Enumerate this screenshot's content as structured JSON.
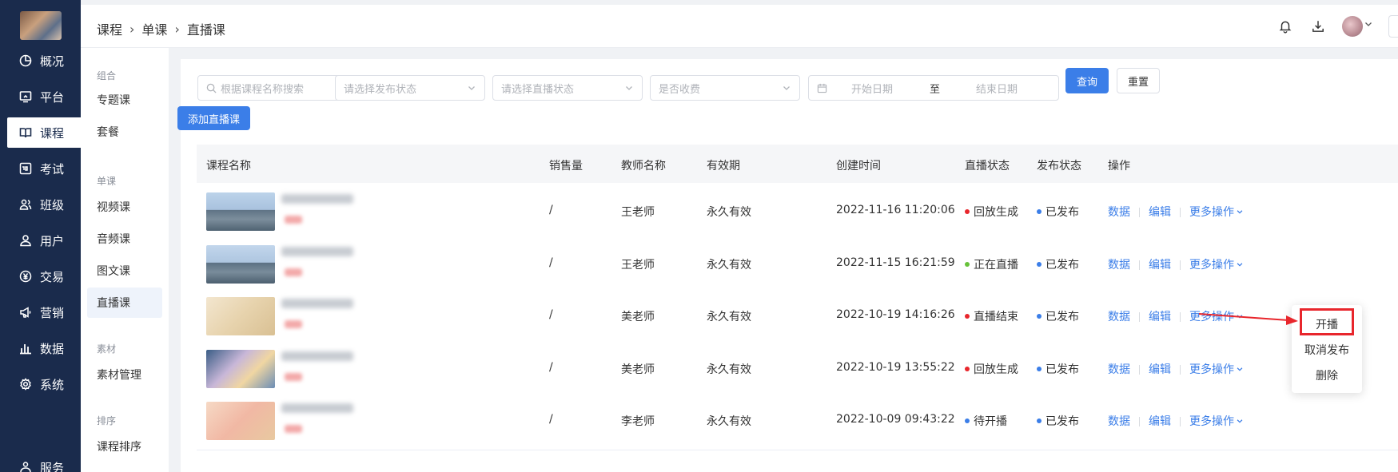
{
  "nav": {
    "items": [
      {
        "label": "概况",
        "icon": "pie-chart-icon"
      },
      {
        "label": "平台",
        "icon": "monitor-icon"
      },
      {
        "label": "课程",
        "icon": "book-icon",
        "active": true
      },
      {
        "label": "考试",
        "icon": "score-icon"
      },
      {
        "label": "班级",
        "icon": "group-icon"
      },
      {
        "label": "用户",
        "icon": "user-icon"
      },
      {
        "label": "交易",
        "icon": "yen-icon"
      },
      {
        "label": "营销",
        "icon": "megaphone-icon"
      },
      {
        "label": "数据",
        "icon": "bar-chart-icon"
      },
      {
        "label": "系统",
        "icon": "gear-icon"
      },
      {
        "label": "服务",
        "icon": "service-icon"
      }
    ]
  },
  "subnav": {
    "groups": [
      {
        "title": "组合",
        "items": [
          "专题课",
          "套餐"
        ]
      },
      {
        "title": "单课",
        "items": [
          "视频课",
          "音频课",
          "图文课",
          "直播课"
        ]
      },
      {
        "title": "素材",
        "items": [
          "素材管理"
        ]
      },
      {
        "title": "排序",
        "items": [
          "课程排序"
        ]
      }
    ],
    "active": "直播课"
  },
  "breadcrumb": [
    "课程",
    "单课",
    "直播课"
  ],
  "filters": {
    "search_placeholder": "根据课程名称搜索",
    "publish_placeholder": "请选择发布状态",
    "live_placeholder": "请选择直播状态",
    "fee_placeholder": "是否收费",
    "start_placeholder": "开始日期",
    "range_sep": "至",
    "end_placeholder": "结束日期",
    "query_label": "查询",
    "reset_label": "重置"
  },
  "add_button": "添加直播课",
  "table": {
    "columns": [
      "课程名称",
      "销售量",
      "教师名称",
      "有效期",
      "创建时间",
      "直播状态",
      "发布状态",
      "操作"
    ],
    "rows": [
      {
        "sales": "/",
        "teacher": "王老师",
        "validity": "永久有效",
        "created": "2022-11-16 11:20:06",
        "live_status": "回放生成",
        "live_color": "#e8262c",
        "publish": "已发布"
      },
      {
        "sales": "/",
        "teacher": "王老师",
        "validity": "永久有效",
        "created": "2022-11-15 16:21:59",
        "live_status": "正在直播",
        "live_color": "#67c23a",
        "publish": "已发布"
      },
      {
        "sales": "/",
        "teacher": "美老师",
        "validity": "永久有效",
        "created": "2022-10-19 14:16:26",
        "live_status": "直播结束",
        "live_color": "#e8262c",
        "publish": "已发布"
      },
      {
        "sales": "/",
        "teacher": "美老师",
        "validity": "永久有效",
        "created": "2022-10-19 13:55:22",
        "live_status": "回放生成",
        "live_color": "#e8262c",
        "publish": "已发布"
      },
      {
        "sales": "/",
        "teacher": "李老师",
        "validity": "永久有效",
        "created": "2022-10-09 09:43:22",
        "live_status": "待开播",
        "live_color": "#3b7ee8",
        "publish": "已发布"
      }
    ],
    "actions": {
      "data": "数据",
      "edit": "编辑",
      "more": "更多操作"
    }
  },
  "dropdown": {
    "items": [
      "开播",
      "取消发布",
      "删除"
    ]
  },
  "colors": {
    "nav_bg": "#1a2b4c",
    "primary": "#3b7ee8",
    "highlight": "#e8262c",
    "published_dot": "#3b7ee8"
  }
}
